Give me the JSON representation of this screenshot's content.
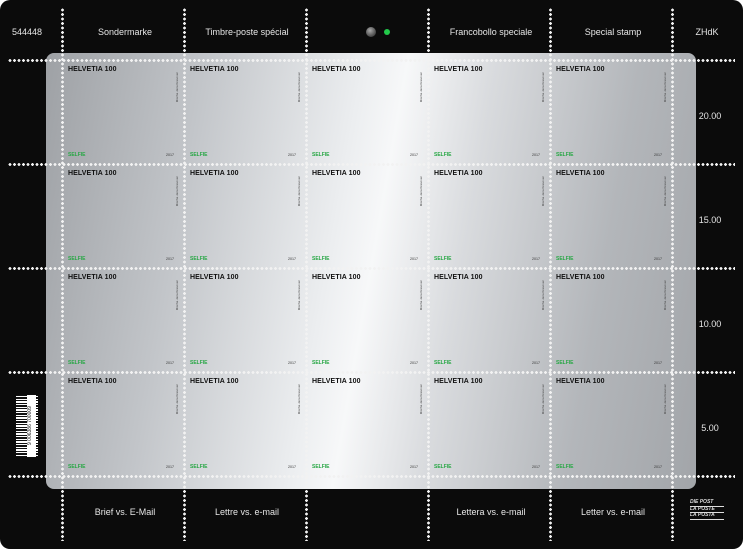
{
  "sheet_number": "544448",
  "top_labels": [
    "Sondermarke",
    "Timbre-poste spécial",
    "Francobollo speciale",
    "Special stamp"
  ],
  "top_right_label": "ZHdK",
  "bottom_labels": [
    "Brief vs. E-Mail",
    "Lettre vs. e-mail",
    "Lettera vs. e-mail",
    "Letter vs. e-mail"
  ],
  "side_values": [
    "20.00",
    "15.00",
    "10.00",
    "5.00"
  ],
  "stamp": {
    "denomination": "HELVETIA 100",
    "name": "SELFIE",
    "year": "2017",
    "credit": "Mischa Jana Krasovec"
  },
  "stamp_grid": {
    "rows": 4,
    "columns": 5
  },
  "colors": {
    "sheet_background": "#0b0b0b",
    "plate_silver": "#c2c5c9",
    "selfie_green": "#28a745",
    "led_green": "#22c94a",
    "label_text": "#e6e6e6"
  },
  "logo_lines": [
    "DIE POST",
    "LA POSTE",
    "LA POSTA"
  ],
  "barcode_digits": "9 006386 700009",
  "icons": [
    "camera-lens-icon",
    "status-led-icon",
    "post-logo-icon",
    "barcode-icon"
  ]
}
